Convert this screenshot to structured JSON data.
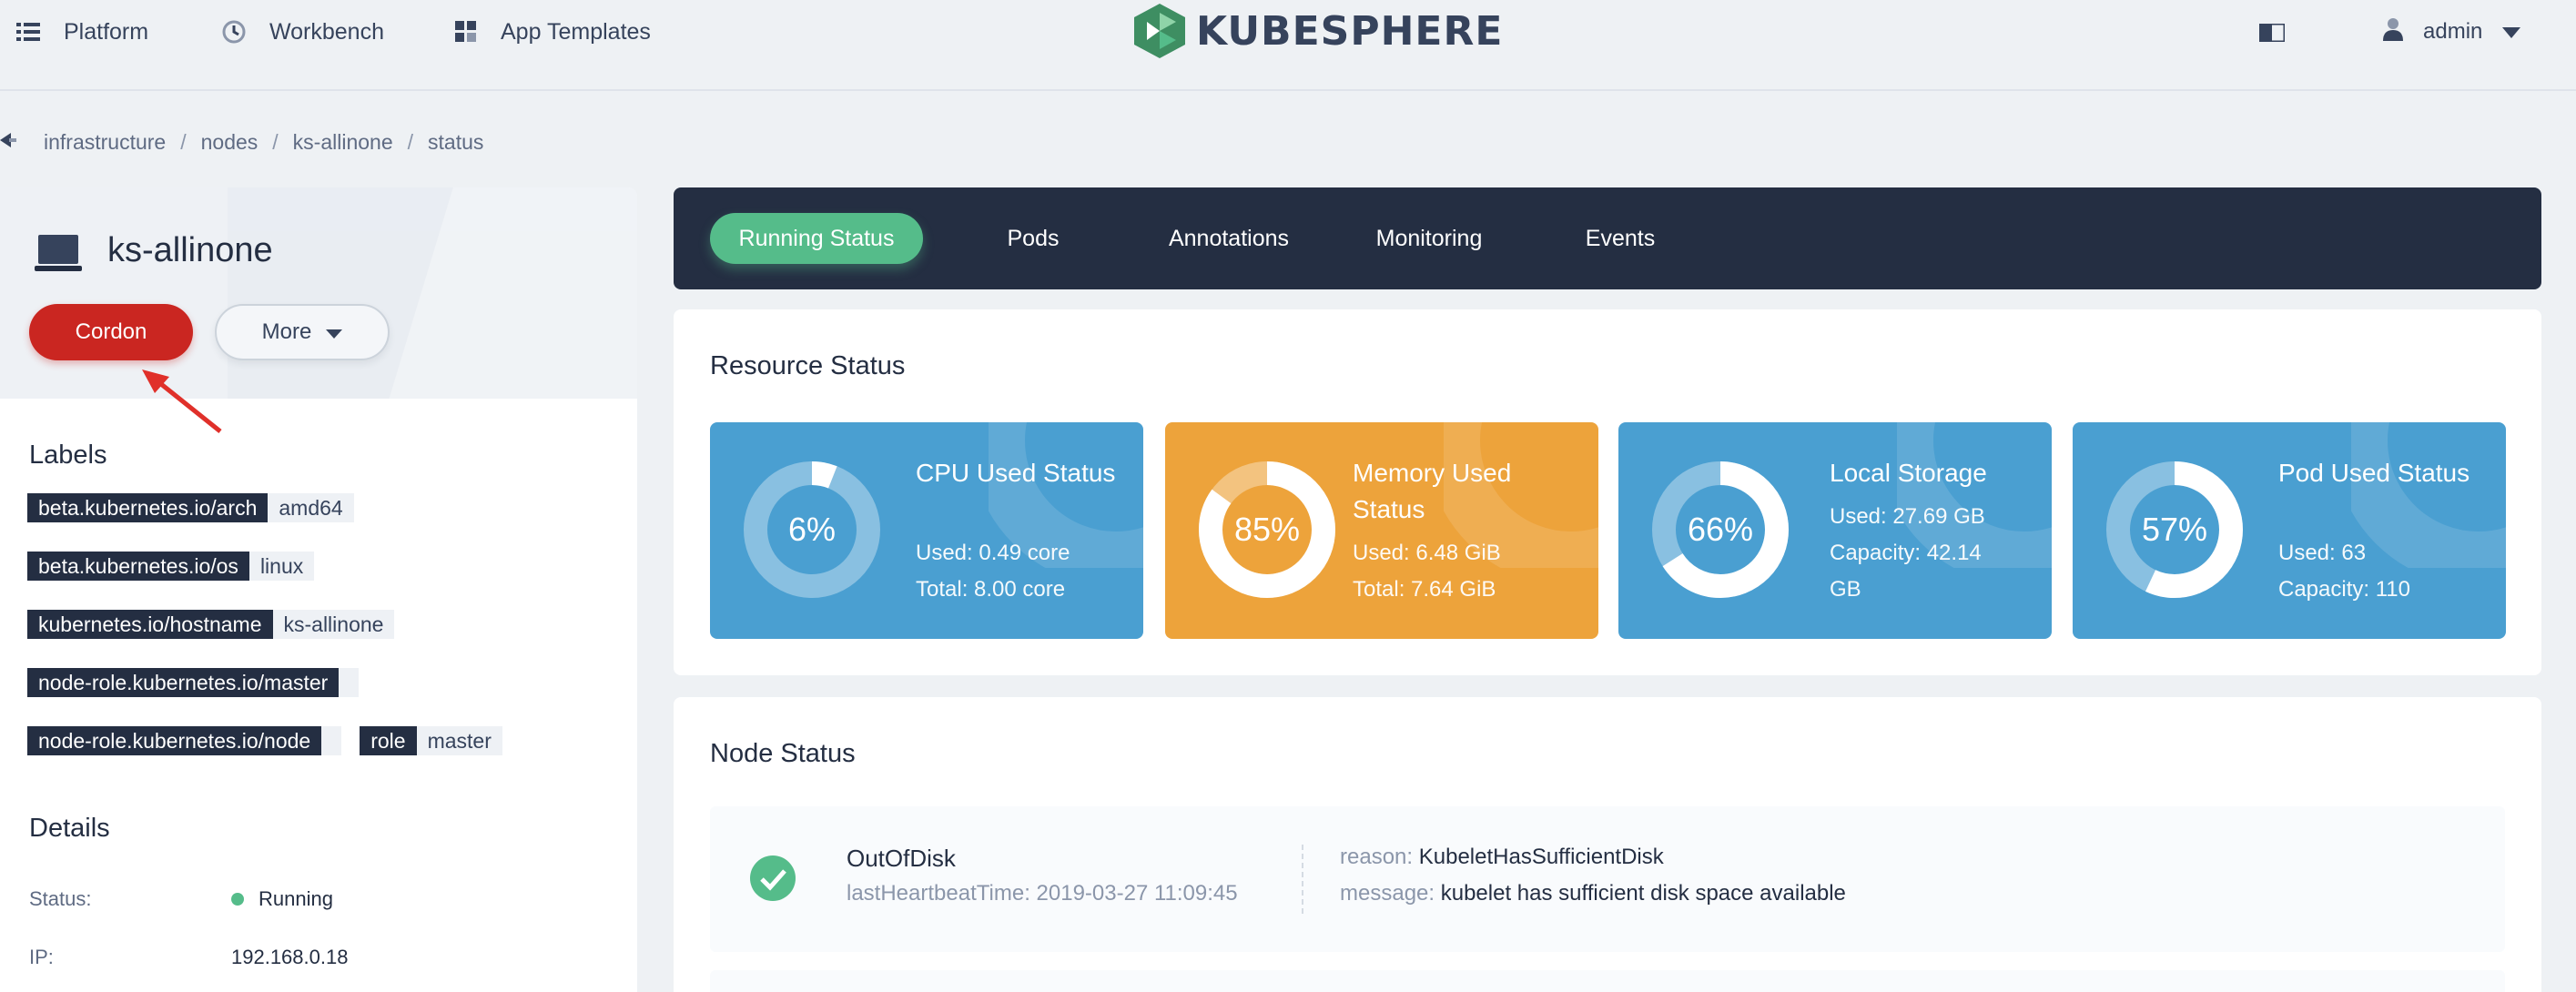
{
  "nav": {
    "platform": "Platform",
    "workbench": "Workbench",
    "app_templates": "App Templates",
    "logo": "KUBESPHERE",
    "user": "admin"
  },
  "breadcrumb": [
    "infrastructure",
    "nodes",
    "ks-allinone",
    "status"
  ],
  "node": {
    "name": "ks-allinone",
    "cordon_label": "Cordon",
    "more_label": "More"
  },
  "labels": {
    "title": "Labels",
    "items": [
      {
        "key": "beta.kubernetes.io/arch",
        "value": "amd64"
      },
      {
        "key": "beta.kubernetes.io/os",
        "value": "linux"
      },
      {
        "key": "kubernetes.io/hostname",
        "value": "ks-allinone"
      },
      {
        "key": "node-role.kubernetes.io/master",
        "value": ""
      },
      {
        "key": "node-role.kubernetes.io/node",
        "value": ""
      },
      {
        "key": "role",
        "value": "master"
      }
    ]
  },
  "details": {
    "title": "Details",
    "status_label": "Status:",
    "status_value": "Running",
    "ip_label": "IP:",
    "ip_value": "192.168.0.18"
  },
  "tabs": [
    "Running Status",
    "Pods",
    "Annotations",
    "Monitoring",
    "Events"
  ],
  "resource_status": {
    "title": "Resource Status",
    "cards": [
      {
        "title": "CPU Used Status",
        "percent": "6%",
        "fraction": 0.06,
        "line1": "Used: 0.49 core",
        "line2": "Total: 8.00 core",
        "color": "#4a9fd1"
      },
      {
        "title": "Memory Used Status",
        "percent": "85%",
        "fraction": 0.85,
        "line1": "Used: 6.48 GiB",
        "line2": "Total: 7.64 GiB",
        "color": "#eda33b"
      },
      {
        "title": "Local Storage",
        "percent": "66%",
        "fraction": 0.66,
        "line1": "Used: 27.69 GB",
        "line2": "Capacity: 42.14 GB",
        "color": "#4a9fd1"
      },
      {
        "title": "Pod Used Status",
        "percent": "57%",
        "fraction": 0.57,
        "line1": "Used: 63",
        "line2": "Capacity: 110",
        "color": "#4a9fd1"
      }
    ]
  },
  "node_status": {
    "title": "Node Status",
    "conditions": [
      {
        "type": "OutOfDisk",
        "heartbeat": "lastHeartbeatTime: 2019-03-27 11:09:45",
        "reason_key": "reason:",
        "reason": "KubeletHasSufficientDisk",
        "message_key": "message:",
        "message": "kubelet has sufficient disk space available"
      }
    ]
  },
  "colors": {
    "primary_dark": "#242e42",
    "success": "#55bc8a",
    "danger": "#ca2621",
    "blue": "#4a9fd1",
    "orange": "#eda33b"
  }
}
